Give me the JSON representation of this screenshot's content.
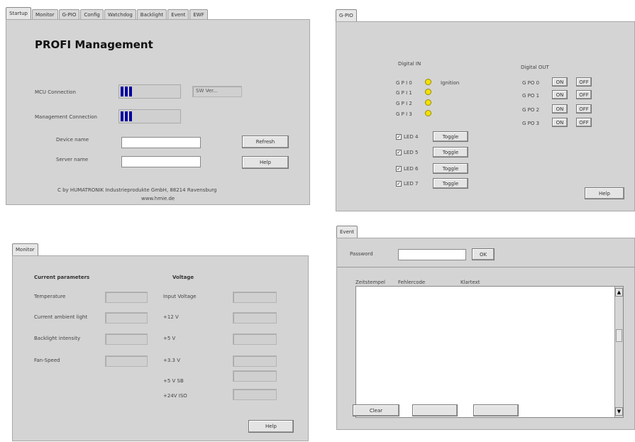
{
  "startup": {
    "tabs": [
      "Startup",
      "Monitor",
      "G-PIO",
      "Config",
      "Watchdog",
      "Backlight",
      "Event",
      "EWF"
    ],
    "title": "PROFI Management",
    "mcu_label": "MCU Connection",
    "sw_ver": "SW Ver...",
    "mgmt_label": "Management Connection",
    "device_label": "Device name",
    "server_label": "Server name",
    "refresh_button": "Refresh",
    "help_button": "Help",
    "copyright": "C by HUMATRONIK Industrieprodukte GmbH, 88214 Ravensburg",
    "website": "www.hmie.de"
  },
  "gpio": {
    "tab": "G-PIO",
    "digital_in_title": "Digital IN",
    "inputs": [
      {
        "label": "G P I 0",
        "note": "Ignition"
      },
      {
        "label": "G P I 1",
        "note": ""
      },
      {
        "label": "G P I 2",
        "note": ""
      },
      {
        "label": "G P I 3",
        "note": ""
      }
    ],
    "digital_out_title": "Digital OUT",
    "outputs": [
      {
        "label": "G PO 0",
        "on": "ON",
        "off": "OFF"
      },
      {
        "label": "G PO 1",
        "on": "ON",
        "off": "OFF"
      },
      {
        "label": "G PO 2",
        "on": "ON",
        "off": "OFF"
      },
      {
        "label": "G PO 3",
        "on": "ON",
        "off": "OFF"
      }
    ],
    "leds": [
      {
        "label": "LED 4",
        "checked": true,
        "toggle": "Toggle"
      },
      {
        "label": "LED 5",
        "checked": true,
        "toggle": "Toggle"
      },
      {
        "label": "LED 6",
        "checked": true,
        "toggle": "Toggle"
      },
      {
        "label": "LED 7",
        "checked": true,
        "toggle": "Toggle"
      }
    ],
    "help_button": "Help"
  },
  "monitor": {
    "tab": "Monitor",
    "current_title": "Current parameters",
    "params": [
      "Temperature",
      "Current ambient light",
      "Backlight intensity",
      "Fan-Speed"
    ],
    "voltage_title": "Voltage",
    "voltages": [
      "Input Voltage",
      "+12 V",
      "+5 V",
      "+3.3 V",
      "+5 V SB",
      "+24V ISO"
    ],
    "help_button": "Help"
  },
  "event": {
    "tab": "Event",
    "password_label": "Password",
    "ok_button": "OK",
    "columns": [
      "Zeitstempel",
      "Fehlercode",
      "Klartext"
    ],
    "clear_button": "Clear",
    "scroll_up": "▲",
    "scroll_down": "▼"
  }
}
